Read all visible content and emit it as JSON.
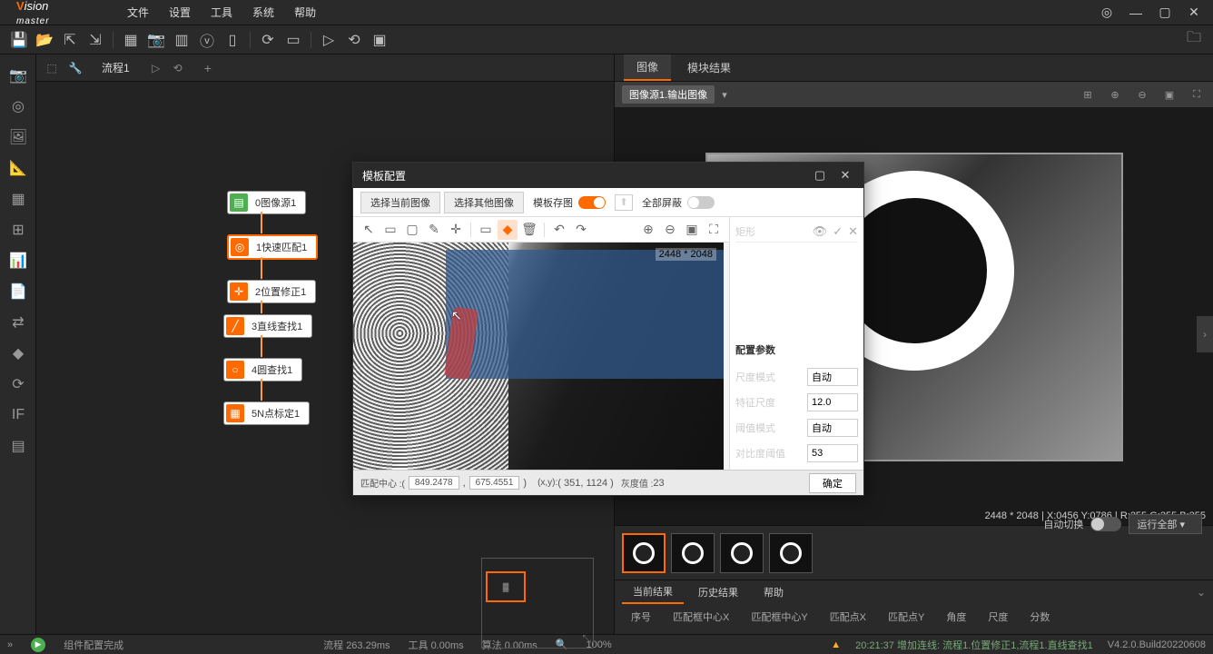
{
  "app": {
    "name": "Vision Master"
  },
  "menus": [
    "文件",
    "设置",
    "工具",
    "系统",
    "帮助"
  ],
  "flow": {
    "tab": "流程1",
    "nodes": [
      {
        "label": "0图像源1"
      },
      {
        "label": "1快速匹配1"
      },
      {
        "label": "2位置修正1"
      },
      {
        "label": "3直线查找1"
      },
      {
        "label": "4圆查找1"
      },
      {
        "label": "5N点标定1"
      }
    ]
  },
  "modal": {
    "title": "模板配置",
    "btn_current": "选择当前图像",
    "btn_other": "选择其他图像",
    "label_save": "模板存图",
    "label_fullscreen": "全部屏蔽",
    "canvas_dims": "2448 * 2048",
    "side_top": "矩形",
    "section": "配置参数",
    "params": {
      "scale_mode_label": "尺度模式",
      "scale_mode_value": "自动",
      "feature_scale_label": "特征尺度",
      "feature_scale_value": "12.0",
      "thresh_mode_label": "阈值模式",
      "thresh_mode_value": "自动",
      "contrast_label": "对比度阈值",
      "contrast_value": "53"
    },
    "footer": {
      "match_center_label": "匹配中心 :(",
      "mc_x": "849.2478",
      "mc_y": "675.4551",
      "xy_label": "(x,y):",
      "xy_val": "( 351, 1124 )",
      "gray_label": "灰度值 :",
      "gray_val": "23",
      "ok": "确定"
    }
  },
  "right_panel": {
    "tabs": {
      "image": "图像",
      "module": "模块结果"
    },
    "source_tag": "图像源1.输出图像",
    "status_text": "2448 * 2048 | X:0456 Y:0786 | R:255 G:255 B:255",
    "auto_switch": "自动切换",
    "run_all": "运行全部",
    "result_tabs": {
      "current": "当前结果",
      "history": "历史结果",
      "help": "帮助"
    },
    "columns": [
      "序号",
      "匹配框中心X",
      "匹配框中心Y",
      "匹配点X",
      "匹配点Y",
      "角度",
      "尺度",
      "分数"
    ]
  },
  "status": {
    "flow_done": "组件配置完成",
    "proc_label": "流程",
    "proc_val": "263.29ms",
    "tool_label": "工具",
    "tool_val": "0.00ms",
    "algo_label": "算法",
    "algo_val": "0.00ms",
    "zoom": "100%",
    "log_time": "20:21:37",
    "log_text": "增加连线: 流程1.位置修正1,流程1.直线查找1",
    "version": "V4.2.0.Build20220608"
  }
}
